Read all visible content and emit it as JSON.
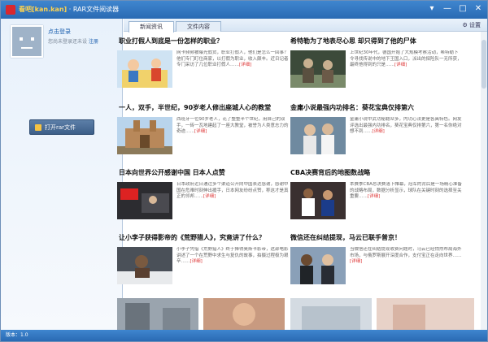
{
  "window": {
    "title_brand": "看吧[kan.kan]",
    "title_rest": " · RAR文件阅读器",
    "controls": [
      "▾",
      "—",
      "□",
      "✕"
    ]
  },
  "sidebar": {
    "login_label": "点击登录",
    "login_hint": "您尚未登录还未设",
    "register_label": "注册",
    "open_button": "打开rar文件"
  },
  "tabs": [
    {
      "label": "新闻资讯",
      "active": true
    },
    {
      "label": "文件内容",
      "active": false
    }
  ],
  "settings_label": "设置",
  "more_label": "[详细]",
  "articles": [
    {
      "title": "职业打假人到底是一份怎样的职业？",
      "body": "网卡频频被曝光假货，职业打假人，他们是怎么一回事？他们专门盯住商家，以打假为职业，收入颇丰。近日记者专门采访了几位职业打假人……"
    },
    {
      "title": "希特勒为了地表尽心思 却只得到了他的尸体",
      "body": "上世纪30年代，德国开始了大规模考察活动，希特勒下令寻找传说中的地下王国入口，派出的探险队一无所获，最终他得到的只是……"
    },
    {
      "title": "一人，双手，半世纪，90岁老人修出座城人心的教堂",
      "body": "西班牙一位90岁老人，花了整整半个世纪，用自己的双手，一砖一瓦地建起了一座大教堂，被誉为人类意志力的奇迹……"
    },
    {
      "title": "金庸小说最强内功排名：葵花宝典仅排第六",
      "body": "金庸小说中武功秘籍众多，内功心法更是各具特色。网友评选出最强内功排名，葵花宝典仅排第六，第一名你绝对想不到……"
    },
    {
      "title": "日本向世界公开感谢中国 日本人点赞",
      "body": "日本政府近日通过多个渠道公开向中国表达感谢，感谢中国在危难时刻伸出援手，日本网友纷纷点赞，称这才是真正的邻邦……"
    },
    {
      "title": "CBA决赛背后的地图数战略",
      "body": "本赛季CBA总决赛落下帷幕，冠军的背后是一场精心准备的战略布局，数据分析显示，球队在关键时刻的选择至关重要……"
    },
    {
      "title": "让小李子获得影帝的《荒野猎人》，究竟讲了什么？",
      "body": "小李子凭借《荒野猎人》终于捧得奥斯卡影帝，这部电影讲述了一个在荒野中求生与复仇的故事，拍摄过程极为艰辛……"
    },
    {
      "title": "微信还在纠结提现，马云已联手普京！",
      "body": "当微信还在纠结提现收费问题时，马云已经悄然布局海外市场，与俄罗斯展开深度合作，支付宝正在走向世界……"
    }
  ],
  "status_text": "版本：1.0"
}
